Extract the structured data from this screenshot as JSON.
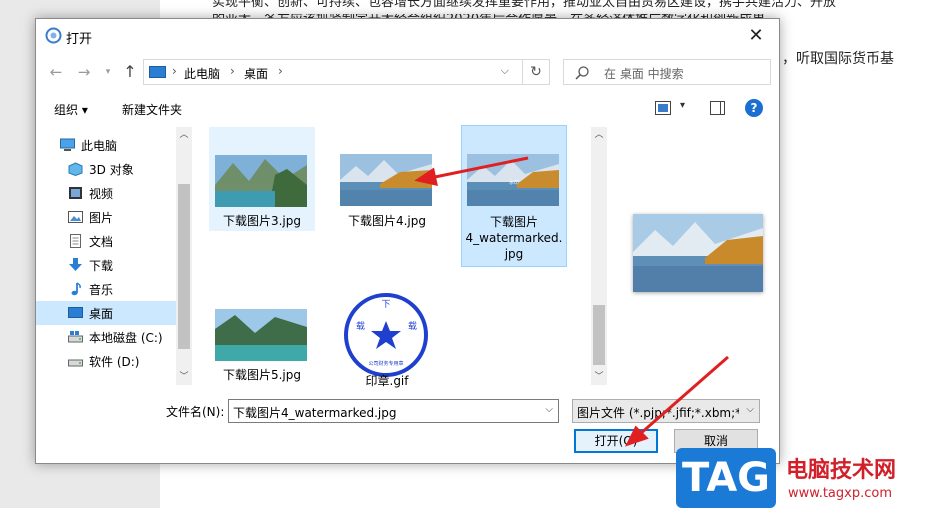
{
  "background_doc": {
    "line1": "实现平衡、创新、可持续、包容增长方面继续发挥重要作用，推动亚太自由贸易区建设，携手共建活力、开放",
    "line2": "的亚太。各方应该抓紧制定开大经合组织2020年后合作愿景，在多经济体推广数字化和创新成果。",
    "right_fragment": "，听取国际货币基"
  },
  "dialog": {
    "title": "打开",
    "close_glyph": "✕",
    "breadcrumbs": [
      "此电脑",
      "桌面"
    ],
    "search_placeholder": "在 桌面 中搜索",
    "toolbar": {
      "organize": "组织 ▾",
      "new_folder": "新建文件夹"
    },
    "nav_items": [
      {
        "label": "此电脑",
        "icon": "computer-icon"
      },
      {
        "label": "3D 对象",
        "icon": "3d-objects-icon"
      },
      {
        "label": "视频",
        "icon": "video-icon"
      },
      {
        "label": "图片",
        "icon": "pictures-icon"
      },
      {
        "label": "文档",
        "icon": "documents-icon"
      },
      {
        "label": "下载",
        "icon": "download-icon"
      },
      {
        "label": "音乐",
        "icon": "music-icon"
      },
      {
        "label": "桌面",
        "icon": "desktop-icon"
      },
      {
        "label": "本地磁盘 (C:)",
        "icon": "disk-icon"
      },
      {
        "label": "软件 (D:)",
        "icon": "disk-icon"
      }
    ],
    "files": [
      {
        "name": "下载图片3.jpg"
      },
      {
        "name": "下载图片4.jpg"
      },
      {
        "name": "下载图片4_watermarked.jpg",
        "display": [
          "下载图片",
          "4_watermarked.",
          "jpg"
        ]
      },
      {
        "name": "下载图片5.jpg"
      },
      {
        "name": "印章.gif"
      }
    ],
    "stamp_text": {
      "top": "下",
      "left": "载",
      "right": "载",
      "bottom": "公司财务专用章"
    },
    "filename_label": "文件名(N):",
    "filename_value": "下载图片4_watermarked.jpg",
    "filetype_value": "图片文件 (*.pjp;*.jfif;*.xbm;*.pjpeg",
    "open_button": "打开(O)",
    "cancel_button": "取消"
  },
  "watermark": {
    "logo_text": "TAG",
    "site_title": "电脑技术网",
    "site_url": "www.tagxp.com"
  },
  "colors": {
    "selection": "#cce8ff",
    "accent": "#0078d7",
    "annotation_red": "#e02020"
  }
}
